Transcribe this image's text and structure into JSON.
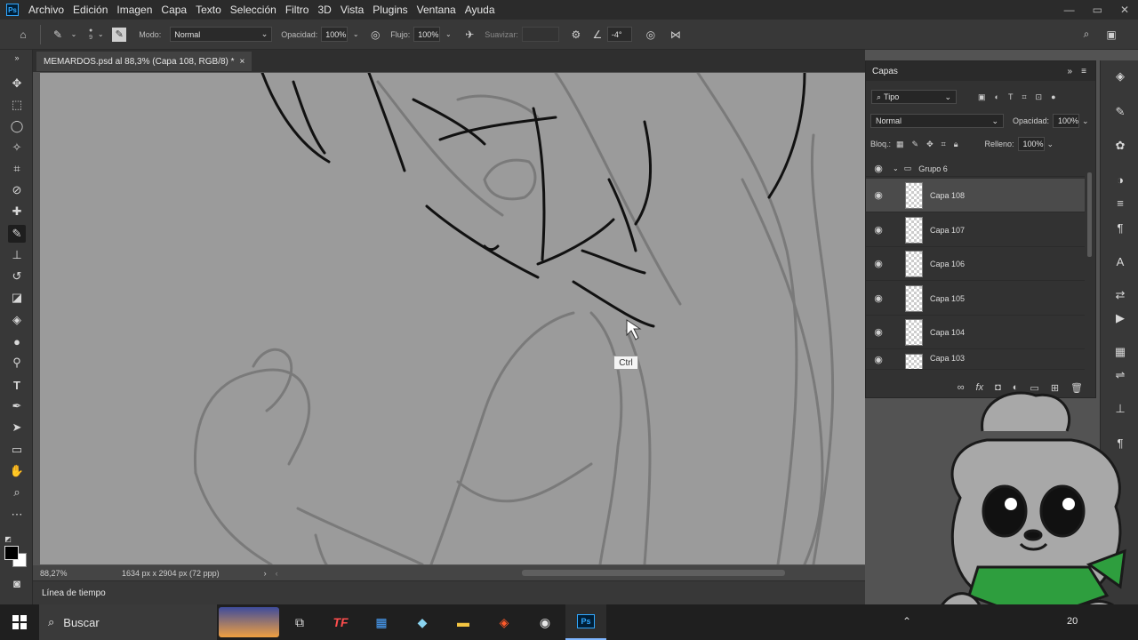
{
  "menubar": {
    "logo": "Ps",
    "items": [
      "Archivo",
      "Edición",
      "Imagen",
      "Capa",
      "Texto",
      "Selección",
      "Filtro",
      "3D",
      "Vista",
      "Plugins",
      "Ventana",
      "Ayuda"
    ],
    "window_controls": [
      "—",
      "▭",
      "✕"
    ]
  },
  "options": {
    "brush_size": "9",
    "mode_label": "Modo:",
    "mode_value": "Normal",
    "opacity_label": "Opacidad:",
    "opacity_value": "100%",
    "flow_label": "Flujo:",
    "flow_value": "100%",
    "smoothing_label": "Suavizar:",
    "smoothing_value": "",
    "angle_value": "-4°"
  },
  "document": {
    "tab_title": "MEMARDOS.psd al 88,3% (Capa 108, RGB/8) *",
    "tooltip": "Ctrl"
  },
  "status": {
    "zoom": "88,27%",
    "doc_info": "1634 px x 2904 px (72 ppp)"
  },
  "timeline": {
    "label": "Línea de tiempo"
  },
  "layers_panel": {
    "title": "Capas",
    "filter_kind": "Tipo",
    "blend_mode": "Normal",
    "opacity_label": "Opacidad:",
    "opacity_value": "100%",
    "lock_label": "Bloq.:",
    "fill_label": "Relleno:",
    "fill_value": "100%",
    "group_name": "Grupo 6",
    "layers": [
      {
        "name": "Capa 108",
        "selected": true
      },
      {
        "name": "Capa 107",
        "selected": false
      },
      {
        "name": "Capa 106",
        "selected": false
      },
      {
        "name": "Capa 105",
        "selected": false
      },
      {
        "name": "Capa 104",
        "selected": false
      },
      {
        "name": "Capa 103",
        "selected": false
      }
    ]
  },
  "taskbar": {
    "search_placeholder": "Buscar",
    "apps": [
      "task-view",
      "tf-app",
      "calculator",
      "notes",
      "file-explorer",
      "brave",
      "obs",
      "photoshop"
    ],
    "tray_text": "20"
  },
  "colors": {
    "menubar_bg": "#2b2b2b",
    "panel_bg": "#383838",
    "canvas_bg": "#9b9b9b",
    "mascot_green": "#2e9e3e"
  }
}
